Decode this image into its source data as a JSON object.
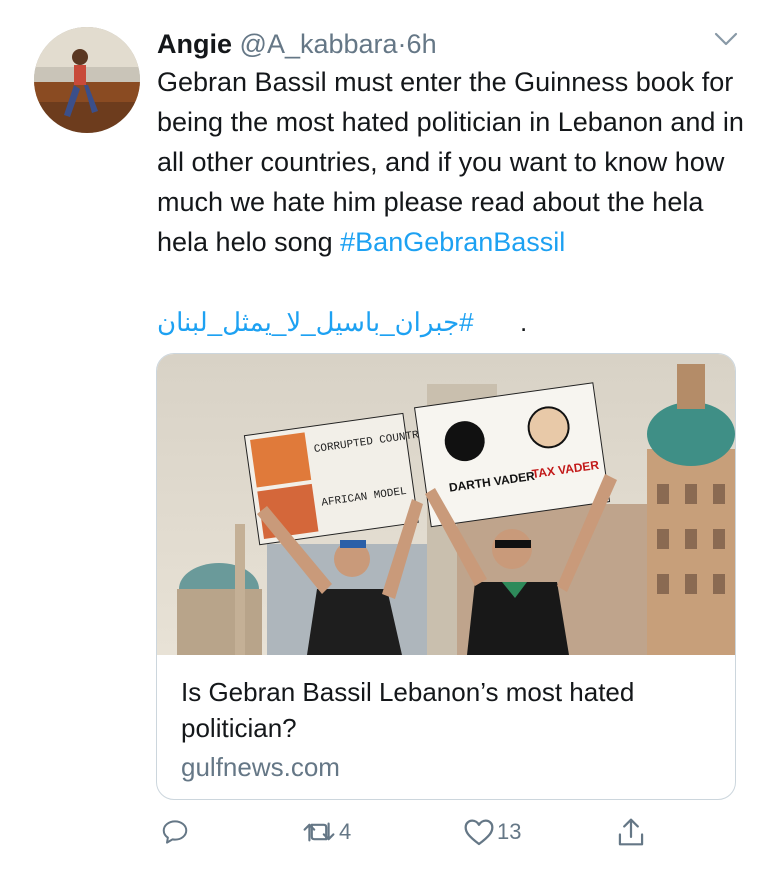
{
  "tweet": {
    "author_name": "Angie",
    "author_handle": "@A_kabbara",
    "separator": "·",
    "time": "6h",
    "text_parts": [
      "Gebran Bassil must enter the Guinness book for being the most hated politician in Lebanon and in all other countries, and if you want to know how much we hate him please read about the hela hela helo song "
    ],
    "hashtag_1": "#BanGebranBassil",
    "hashtag_2": "#جبران_باسيل_لا_يمثل_لبنان",
    "hashtag_2_trailing": "."
  },
  "card": {
    "image_signs": {
      "left_top": "CORRUPTED COUNTRY",
      "left_bottom": "AFRICAN MODEL",
      "right_left": "DARTH VADER",
      "right_right": "TAX VADER"
    },
    "title": "Is Gebran Bassil Lebanon’s most hated politician?",
    "domain": "gulfnews.com"
  },
  "actions": {
    "reply_icon": "reply-icon",
    "retweet_icon": "retweet-icon",
    "retweet_count": "4",
    "like_icon": "heart-icon",
    "like_count": "13",
    "share_icon": "share-icon"
  },
  "colors": {
    "link": "#1da1f2",
    "secondary_text": "#657786",
    "border": "#ccd6dd"
  }
}
